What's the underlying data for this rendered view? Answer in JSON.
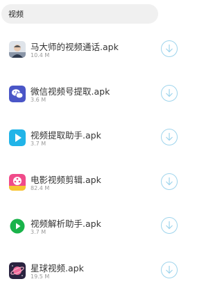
{
  "search": {
    "query": "视频"
  },
  "files": [
    {
      "name": "马大师的视频通话.apk",
      "size": "10.4 M",
      "icon": "person-photo-icon"
    },
    {
      "name": "微信视频号提取.apk",
      "size": "3.6 M",
      "icon": "wechat-icon"
    },
    {
      "name": "视频提取助手.apk",
      "size": "3.7 M",
      "icon": "play-icon"
    },
    {
      "name": "电影视频剪辑.apk",
      "size": "82.4 M",
      "icon": "film-reel-icon"
    },
    {
      "name": "视频解析助手.apk",
      "size": "3.7 M",
      "icon": "green-play-icon"
    },
    {
      "name": "星球视频.apk",
      "size": "19.5 M",
      "icon": "planet-icon"
    }
  ],
  "colors": {
    "download_ring": "#9ed4ec",
    "wechat": "#4a56c7",
    "play": "#21b4e8",
    "green_play": "#19b34a"
  }
}
